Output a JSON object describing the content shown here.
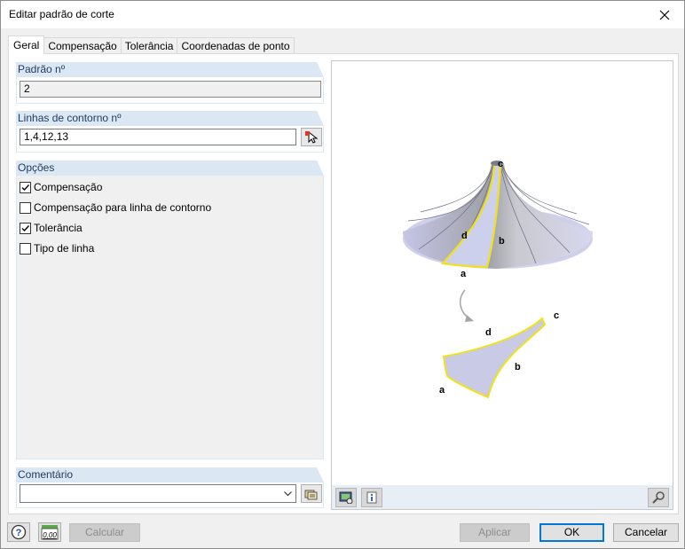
{
  "window": {
    "title": "Editar padrão de corte"
  },
  "tabs": [
    {
      "label": "Geral",
      "active": true
    },
    {
      "label": "Compensação",
      "active": false
    },
    {
      "label": "Tolerância",
      "active": false
    },
    {
      "label": "Coordenadas de ponto",
      "active": false
    }
  ],
  "pattern_no": {
    "label": "Padrão nº",
    "value": "2"
  },
  "boundary_lines": {
    "label": "Linhas de contorno nº",
    "value": "1,4,12,13"
  },
  "options": {
    "label": "Opções",
    "items": [
      {
        "label": "Compensação",
        "checked": true
      },
      {
        "label": "Compensação para linha de contorno",
        "checked": false
      },
      {
        "label": "Tolerância",
        "checked": true
      },
      {
        "label": "Tipo de linha",
        "checked": false
      }
    ]
  },
  "comment": {
    "label": "Comentário",
    "value": ""
  },
  "figure": {
    "labels": {
      "a_top": "a",
      "b_top": "b",
      "c_top": "c",
      "d_top": "d",
      "a_bottom": "a",
      "b_bottom": "b",
      "c_bottom": "c",
      "d_bottom": "d"
    }
  },
  "buttons": {
    "calculate": "Calcular",
    "apply": "Aplicar",
    "ok": "OK",
    "cancel": "Cancelar"
  },
  "calc_icon_text": "0,00",
  "colors": {
    "accent": "#0078d7",
    "group_header": "#dbe7f3",
    "surface": "#c9cbe6",
    "highlight": "#f0e21a"
  }
}
